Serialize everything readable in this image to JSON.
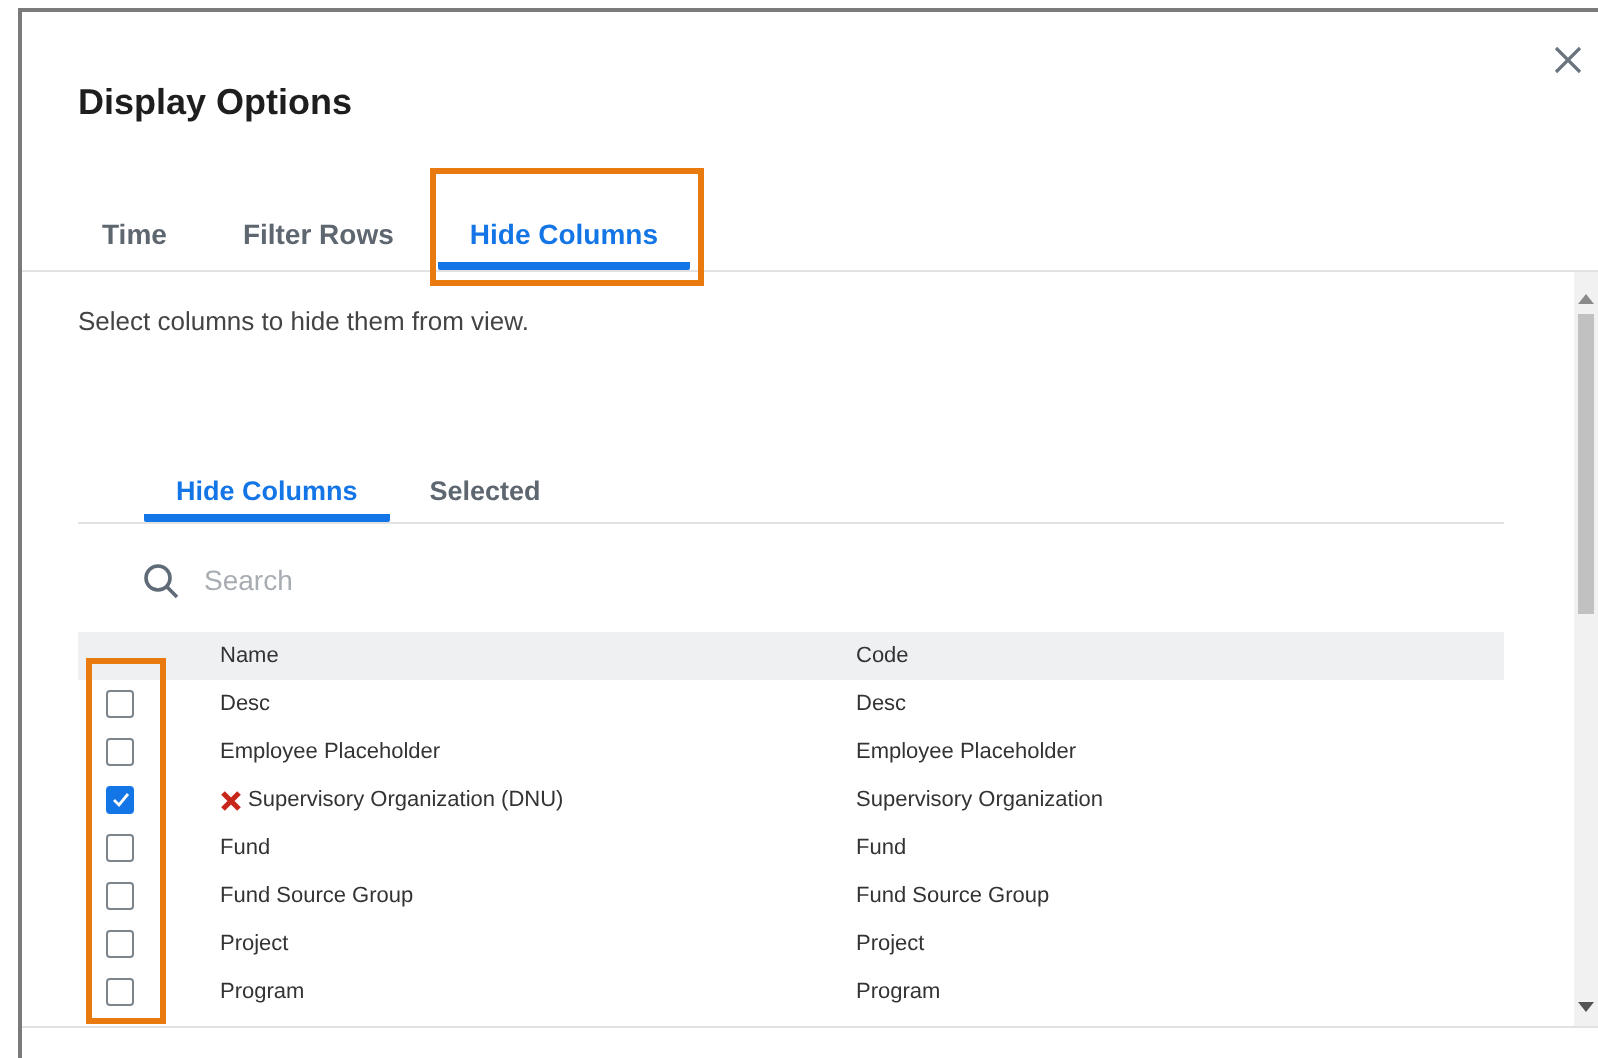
{
  "dialog": {
    "title": "Display Options"
  },
  "tabs": [
    {
      "label": "Time",
      "selected": false
    },
    {
      "label": "Filter Rows",
      "selected": false
    },
    {
      "label": "Hide Columns",
      "selected": true
    }
  ],
  "description": "Select columns to hide them from view.",
  "subtabs": [
    {
      "label": "Hide Columns",
      "selected": true
    },
    {
      "label": "Selected",
      "selected": false
    }
  ],
  "search": {
    "placeholder": "Search"
  },
  "table": {
    "columns": [
      "Name",
      "Code"
    ],
    "rows": [
      {
        "name": "Desc",
        "code": "Desc",
        "checked": false,
        "flagged": false
      },
      {
        "name": "Employee Placeholder",
        "code": "Employee Placeholder",
        "checked": false,
        "flagged": false
      },
      {
        "name": "Supervisory Organization (DNU)",
        "code": "Supervisory Organization",
        "checked": true,
        "flagged": true
      },
      {
        "name": "Fund",
        "code": "Fund",
        "checked": false,
        "flagged": false
      },
      {
        "name": "Fund Source Group",
        "code": "Fund Source Group",
        "checked": false,
        "flagged": false
      },
      {
        "name": "Project",
        "code": "Project",
        "checked": false,
        "flagged": false
      },
      {
        "name": "Program",
        "code": "Program",
        "checked": false,
        "flagged": false
      }
    ]
  }
}
